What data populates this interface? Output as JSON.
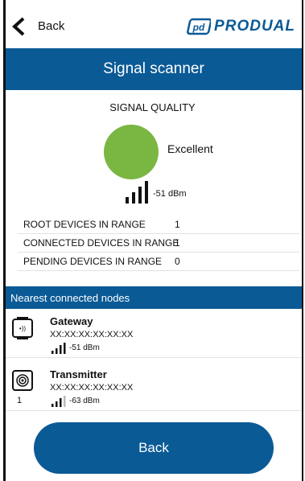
{
  "topbar": {
    "back_label": "Back",
    "logo_text": "PRODUAL",
    "logo_mark_icon": "produal-logo-icon"
  },
  "title": "Signal scanner",
  "signal": {
    "heading": "SIGNAL QUALITY",
    "quality": "Excellent",
    "quality_color": "#7ab642",
    "dbm": "-51 dBm",
    "bars_level": 4
  },
  "stats": [
    {
      "label": "ROOT DEVICES IN RANGE",
      "value": "1"
    },
    {
      "label": "CONNECTED DEVICES IN RANGE",
      "value": "1"
    },
    {
      "label": "PENDING DEVICES IN RANGE",
      "value": "0"
    }
  ],
  "nodes_header": "Nearest connected nodes",
  "nodes": [
    {
      "name": "Gateway",
      "mac": "XX:XX:XX:XX:XX:XX",
      "dbm": "-51 dBm",
      "index": "",
      "icon": "gateway-icon",
      "bars_level": 4
    },
    {
      "name": "Transmitter",
      "mac": "XX:XX:XX:XX:XX:XX",
      "dbm": "-63 dBm",
      "index": "1",
      "icon": "transmitter-icon",
      "bars_level": 3
    }
  ],
  "back_button_label": "Back",
  "colors": {
    "brand": "#0a5a96",
    "signal_good": "#7ab642"
  }
}
